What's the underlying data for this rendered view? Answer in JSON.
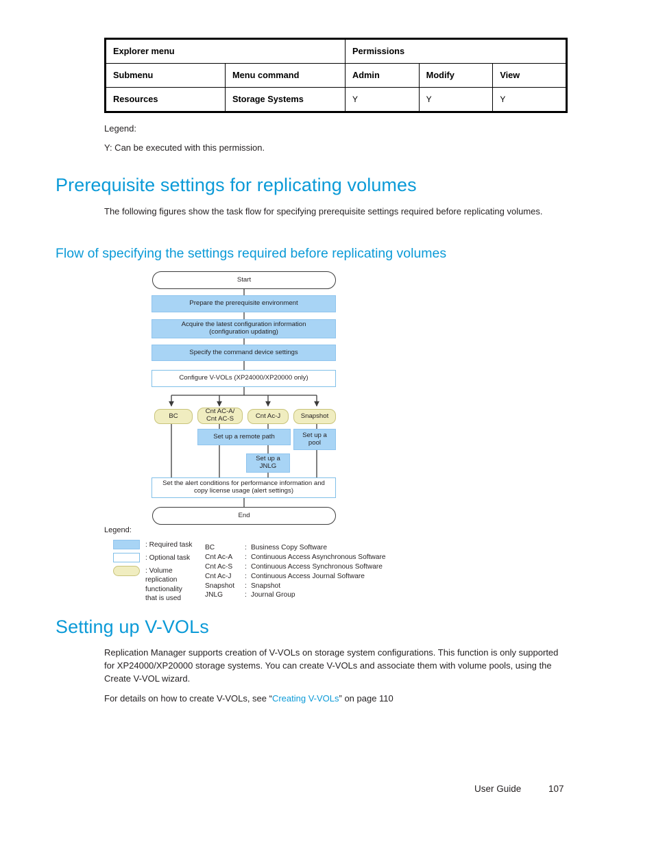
{
  "permission_table": {
    "group_headers": [
      "Explorer menu",
      "Permissions"
    ],
    "columns": [
      "Submenu",
      "Menu command",
      "Admin",
      "Modify",
      "View"
    ],
    "rows": [
      [
        "Resources",
        "Storage Systems",
        "Y",
        "Y",
        "Y"
      ]
    ]
  },
  "table_legend": {
    "title": "Legend:",
    "note": "Y: Can be executed with this permission."
  },
  "sections": {
    "heading1": "Prerequisite settings for replicating volumes",
    "intro": "The following figures show the task flow for specifying prerequisite settings required before replicating volumes.",
    "heading2": "Flow of specifying the settings required before replicating volumes",
    "heading3": "Setting up V-VOLs",
    "body1": "Replication Manager supports creation of V-VOLs on storage system configurations. This function is only supported for XP24000/XP20000 storage systems. You can create V-VOLs and associate them with volume pools, using the Create V-VOL wizard.",
    "body2_prefix": "For details on how to create V-VOLs, see “",
    "body2_link": "Creating V-VOLs",
    "body2_suffix": "” on page 110"
  },
  "flowchart": {
    "nodes": {
      "start": "Start",
      "prepare": "Prepare the prerequisite environment",
      "acquire": "Acquire the latest configuration information\n(configuration updating)",
      "command_device": "Specify the command device settings",
      "configure_vvols": "Configure V-VOLs (XP24000/XP20000 only)",
      "bc": "BC",
      "cnt_ac_as": "Cnt AC-A/\nCnt AC-S",
      "cnt_ac_j": "Cnt Ac-J",
      "snapshot": "Snapshot",
      "remote_path": "Set up a remote path",
      "pool": "Set up a\npool",
      "jnlg": "Set up a\nJNLG",
      "alert": "Set the alert conditions for performance information and\ncopy license usage (alert settings)",
      "end": "End"
    },
    "colors": {
      "required_task": "#a8d4f5",
      "optional_task": "#ffffff",
      "volume_functionality": "#f0edc0",
      "line": "#3a3a3a",
      "heading_blue": "#0b9ad7"
    },
    "legend": {
      "title": "Legend:",
      "swatches": [
        ": Required task",
        ": Optional task",
        ": Volume\n   replication\n   functionality\n   that is used"
      ],
      "abbreviations": [
        {
          "key": "BC",
          "value": "Business Copy Software"
        },
        {
          "key": "Cnt Ac-A",
          "value": "Continuous Access Asynchronous Software"
        },
        {
          "key": "Cnt Ac-S",
          "value": "Continuous Access Synchronous Software"
        },
        {
          "key": "Cnt Ac-J",
          "value": "Continuous Access Journal Software"
        },
        {
          "key": "Snapshot",
          "value": "Snapshot"
        },
        {
          "key": "JNLG",
          "value": "Journal Group"
        }
      ]
    }
  },
  "footer": {
    "label": "User Guide",
    "page": "107"
  }
}
